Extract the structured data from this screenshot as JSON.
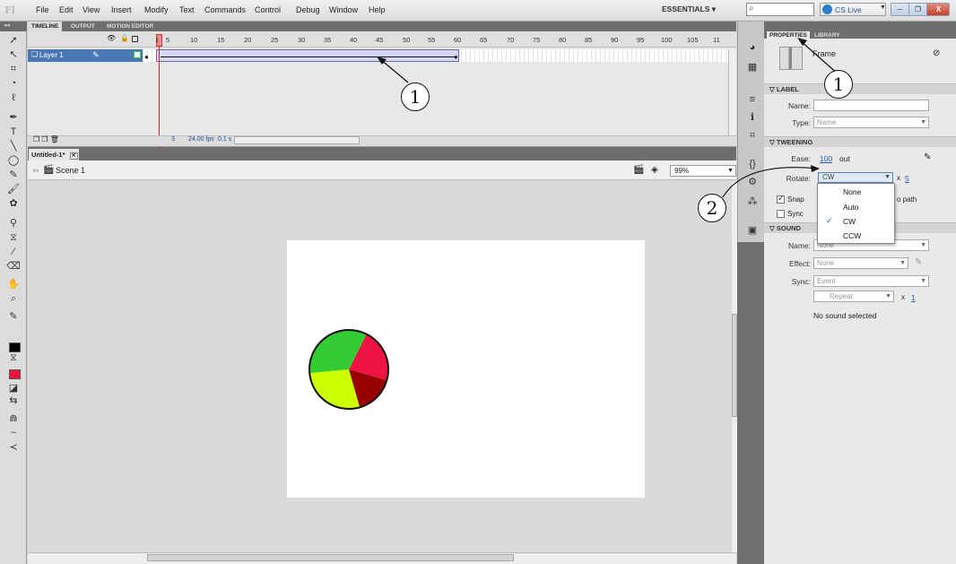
{
  "menu": {
    "logo": "Fl",
    "items": [
      "File",
      "Edit",
      "View",
      "Insert",
      "Modify",
      "Text",
      "Commands",
      "Control",
      "Debug",
      "Window",
      "Help"
    ],
    "workspace": "ESSENTIALS ▾",
    "search_icon": "search-icon",
    "cs_live": "CS Live",
    "window_controls": {
      "minimize": "─",
      "maximize": "❐",
      "close": "X"
    }
  },
  "timeline": {
    "tabs": [
      "TIMELINE",
      "OUTPUT",
      "MOTION EDITOR"
    ],
    "frame_numbers": [
      "1",
      "5",
      "10",
      "15",
      "20",
      "25",
      "30",
      "35",
      "40",
      "45",
      "50",
      "55",
      "60",
      "65",
      "70",
      "75",
      "80",
      "85",
      "90",
      "95",
      "100",
      "105",
      "11"
    ],
    "layer_name": "Layer 1",
    "status": {
      "current_frame": "3",
      "fps": "24.00 fps",
      "time": "0.1 s"
    }
  },
  "document": {
    "tab": "Untitled-1*",
    "scene": "Scene 1",
    "zoom": "99%"
  },
  "pie": {
    "colors": {
      "red": "#ee1340",
      "dark_red": "#990000",
      "yellow": "#ccff00",
      "green": "#33cc33"
    }
  },
  "properties": {
    "tabs": [
      "PROPERTIES",
      "LIBRARY"
    ],
    "object_type": "Frame",
    "label_section": "LABEL",
    "name_label": "Name:",
    "type_label": "Type:",
    "type_value": "Name",
    "tweening_section": "TWEENING",
    "ease_label": "Ease:",
    "ease_value": "100",
    "ease_unit": "out",
    "rotate_label": "Rotate:",
    "rotate_value": "CW",
    "rotate_times": "x",
    "rotate_count": "5",
    "rotate_options": [
      "None",
      "Auto",
      "CW",
      "CCW"
    ],
    "rotate_selected": "CW",
    "snap_label": "Snap",
    "path_label": "o path",
    "sync_label": "Sync",
    "sound_section": "SOUND",
    "sound_name_label": "Name:",
    "sound_name_value": "None",
    "effect_label": "Effect:",
    "effect_value": "None",
    "sound_sync_label": "Sync:",
    "sync_value": "Event",
    "repeat_value": "Repeat",
    "repeat_times": "x",
    "repeat_count": "1",
    "no_sound": "No sound selected"
  },
  "callouts": {
    "one": "1",
    "two": "2"
  }
}
